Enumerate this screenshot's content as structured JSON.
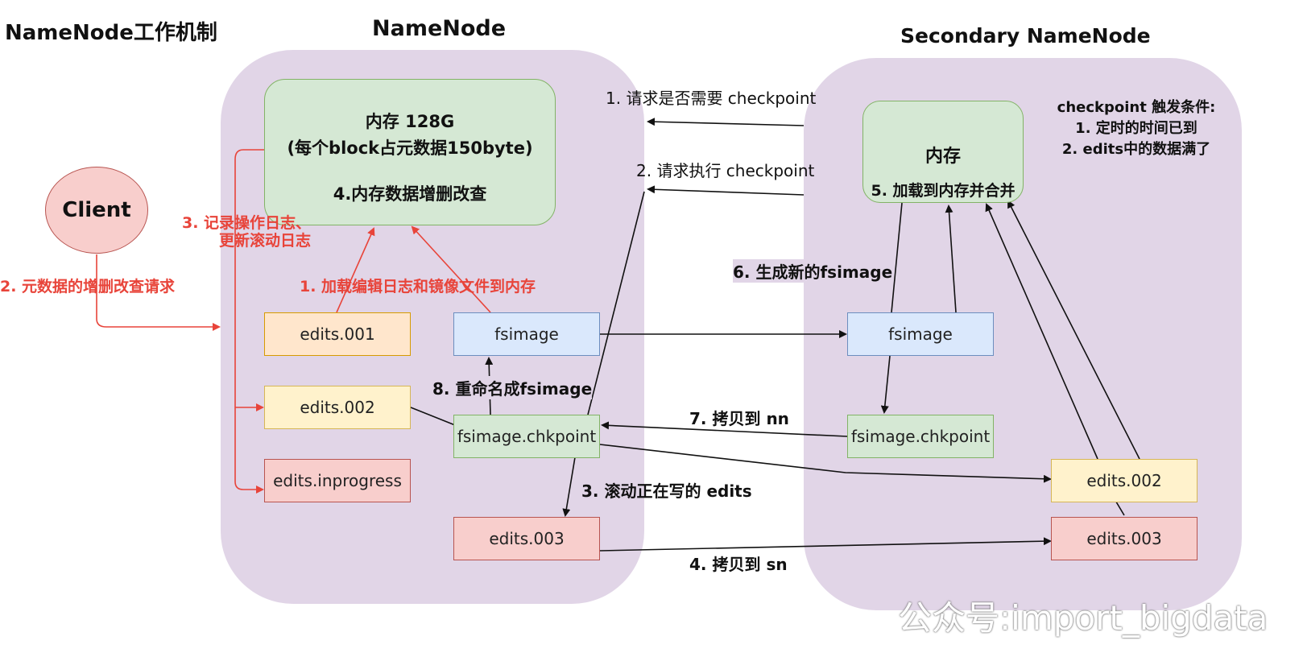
{
  "title": "NameNode工作机制",
  "namenode": {
    "title": "NameNode",
    "memory": {
      "line1": "内存 128G",
      "line2": "(每个block占元数据150byte)",
      "line3": "4.内存数据增删改查"
    },
    "files": {
      "edits001": "edits.001",
      "edits002": "edits.002",
      "inprogress": "edits.inprogress",
      "fsimage": "fsimage",
      "chkpoint": "fsimage.chkpoint",
      "edits003": "edits.003"
    }
  },
  "client": "Client",
  "secondary": {
    "title": "Secondary NameNode",
    "memory": {
      "line1": "内存",
      "line2": "5. 加载到内存并合并"
    },
    "trigger": {
      "line1": "checkpoint 触发条件:",
      "line2": "1. 定时的时间已到",
      "line3": "2. edits中的数据满了"
    },
    "files": {
      "fsimage": "fsimage",
      "chkpoint": "fsimage.chkpoint",
      "edits002": "edits.002",
      "edits003": "edits.003"
    }
  },
  "labels": {
    "request_checkpoint": "1. 请求是否需要 checkpoint",
    "exec_checkpoint": "2. 请求执行 checkpoint",
    "gen_fsimage": "6. 生成新的fsimage",
    "copy_nn": "7. 拷贝到 nn",
    "rename": "8. 重命名成fsimage",
    "roll_edits": "3. 滚动正在写的 edits",
    "copy_sn": "4. 拷贝到 sn",
    "load_to_mem": "1. 加载编辑日志和镜像文件到内存",
    "record_log_1": "3. 记录操作日志、",
    "record_log_2": "更新滚动日志",
    "client_request": "2. 元数据的增删改查请求"
  },
  "watermark": "公众号:import_bigdata",
  "colors": {
    "red": "#e8443a",
    "region": "#e1d5e7",
    "arrow": "#111111"
  }
}
